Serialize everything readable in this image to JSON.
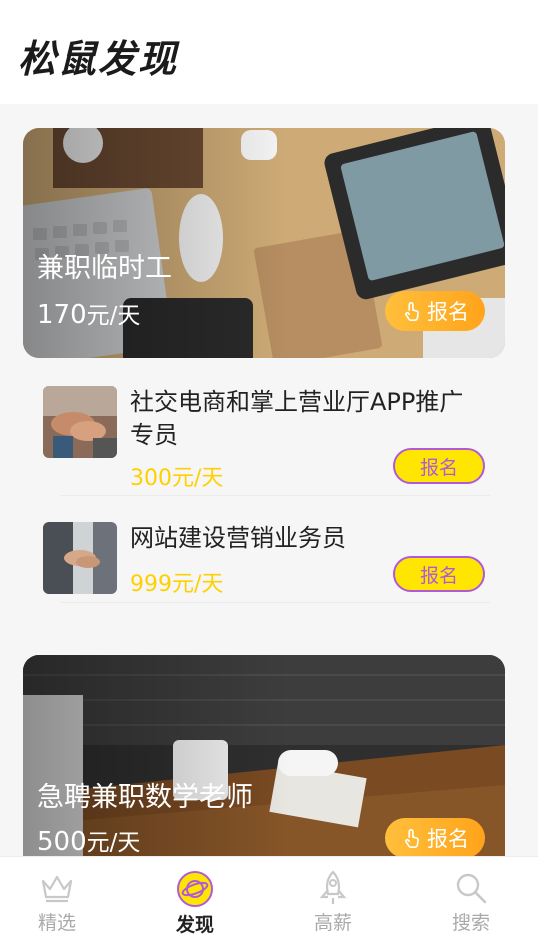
{
  "header": {
    "title": "松鼠发现"
  },
  "featured": [
    {
      "title": "兼职临时工",
      "price": "170",
      "unit": "元/天",
      "button": "报名"
    },
    {
      "title": "急聘兼职数学老师",
      "price": "500",
      "unit": "元/天",
      "button": "报名"
    }
  ],
  "jobs": [
    {
      "title": "社交电商和掌上营业厅APP推广专员",
      "price": "300元/天",
      "button": "报名"
    },
    {
      "title": "网站建设营销业务员",
      "price": "999元/天",
      "button": "报名"
    }
  ],
  "tabbar": [
    {
      "label": "精选",
      "icon": "crown-icon"
    },
    {
      "label": "发现",
      "icon": "planet-icon",
      "active": true
    },
    {
      "label": "高薪",
      "icon": "rocket-icon"
    },
    {
      "label": "搜索",
      "icon": "search-icon"
    }
  ],
  "colors": {
    "accent_orange": "#ffa41b",
    "price_yellow": "#ffd000",
    "button_yellow": "#ffe600",
    "button_purple": "#b159d8"
  }
}
